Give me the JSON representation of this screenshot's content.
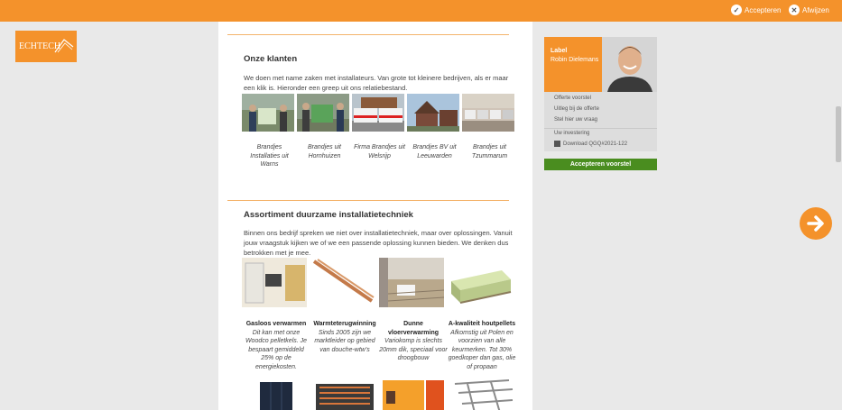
{
  "topbar": {
    "accept_label": "Accepteren",
    "reject_label": "Afwijzen"
  },
  "logo": {
    "text": "ECHTECH"
  },
  "clients_section": {
    "title": "Onze klanten",
    "intro": "We doen met name zaken met installateurs. Van grote tot kleinere bedrijven, als er maar een klik is. Hieronder een greep uit ons relatiebestand.",
    "items": [
      {
        "caption": "Brandjes Installaties uit Warns"
      },
      {
        "caption": "Brandjes uit Hornhuizen"
      },
      {
        "caption": "Firma Brandjes uit Welsrijp"
      },
      {
        "caption": "Brandjes BV uit Leeuwarden"
      },
      {
        "caption": "Brandjes uit Tzummarum"
      }
    ]
  },
  "assortment_section": {
    "title": "Assortiment duurzame installatietechniek",
    "intro": "Binnen ons bedrijf spreken we niet over installatietechniek, maar over oplossingen. Vanuit jouw vraagstuk kijken we of we een passende oplossing kunnen bieden. We denken dus betrokken met je mee.",
    "products": [
      {
        "title": "Gasloos verwarmen",
        "desc": "Dit kan met onze Woodco pelletkels. Je bespaart gemiddeld 25% op de energiekosten."
      },
      {
        "title": "Warmteterugwinning",
        "desc": "Sinds 2005 zijn we marktleider op gebied van douche-wtw's"
      },
      {
        "title": "Dunne vloerverwarming",
        "desc": "Variokomp is slechts 20mm dik, speciaal voor droogbouw"
      },
      {
        "title": "A-kwaliteit houtpellets",
        "desc": "Afkomstig uit Polen en voorzien van alle keurmerken. Tot 30% goedkoper dan gas, olie of propaan"
      }
    ]
  },
  "sidebar": {
    "label_key": "Label",
    "label_value": "Robin Dielemans",
    "menu": [
      "Offerte voorstel",
      "Uitleg bij de offerte",
      "Stel hier uw vraag",
      "Uw investering",
      "Download QGQ#2021-122"
    ],
    "accept_button": "Accepteren voorstel"
  },
  "colors": {
    "accent": "#f4922b",
    "success": "#4a8d1f"
  }
}
